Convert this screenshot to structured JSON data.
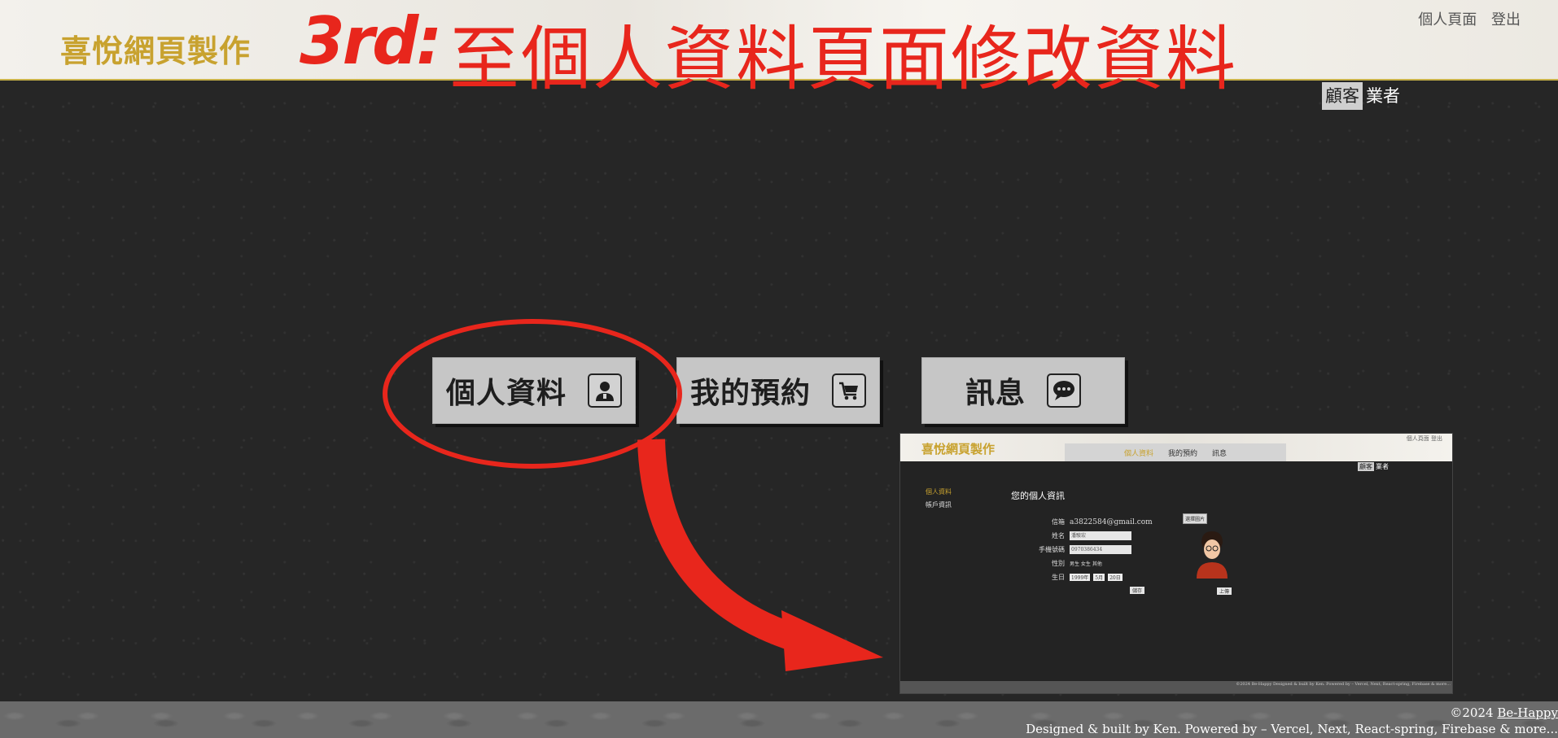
{
  "header": {
    "brand": "喜悅網頁製作",
    "step_label": "3rd:",
    "step_title": "至個人資料頁面修改資料",
    "links": [
      "個人頁面",
      "登出"
    ]
  },
  "roles": {
    "customer": "顧客",
    "vendor": "業者"
  },
  "tabs": [
    {
      "label": "個人資料",
      "icon": "person-icon"
    },
    {
      "label": "我的預約",
      "icon": "cart-icon"
    },
    {
      "label": "訊息",
      "icon": "chat-bubble-icon"
    }
  ],
  "preview": {
    "brand": "喜悅網頁製作",
    "nav": [
      "個人資料",
      "我的預約",
      "訊息"
    ],
    "top_links": "個人頁面  登出",
    "roles": [
      "顧客",
      "業者"
    ],
    "side": [
      "個人資料",
      "帳戶資訊"
    ],
    "title": "您的個人資訊",
    "fields": {
      "email_label": "信箱",
      "email_value": "a3822584@gmail.com",
      "name_label": "姓名",
      "name_value": "潘駿宏",
      "phone_label": "手機號碼",
      "phone_value": "0970386434",
      "gender_label": "性別",
      "gender_options": "男生  女生  其他",
      "birthday_label": "生日",
      "birthday_selects": [
        "1999年",
        "5月",
        "20日"
      ]
    },
    "save": "儲存",
    "pick_avatar": "選擇圖片",
    "upload": "上傳",
    "footer": "©2024 Be-Happy  Designed & built by Ken. Powered by – Vercel, Next, React-spring, Firebase & more..."
  },
  "footer": {
    "copyright": "©2024",
    "brand_link": "Be-Happy",
    "credits": "Designed & built by Ken. Powered by – Vercel, Next, React-spring, Firebase & more..."
  },
  "colors": {
    "accent_red": "#e8261c",
    "brand_gold": "#c8a22f",
    "background": "#262626"
  }
}
